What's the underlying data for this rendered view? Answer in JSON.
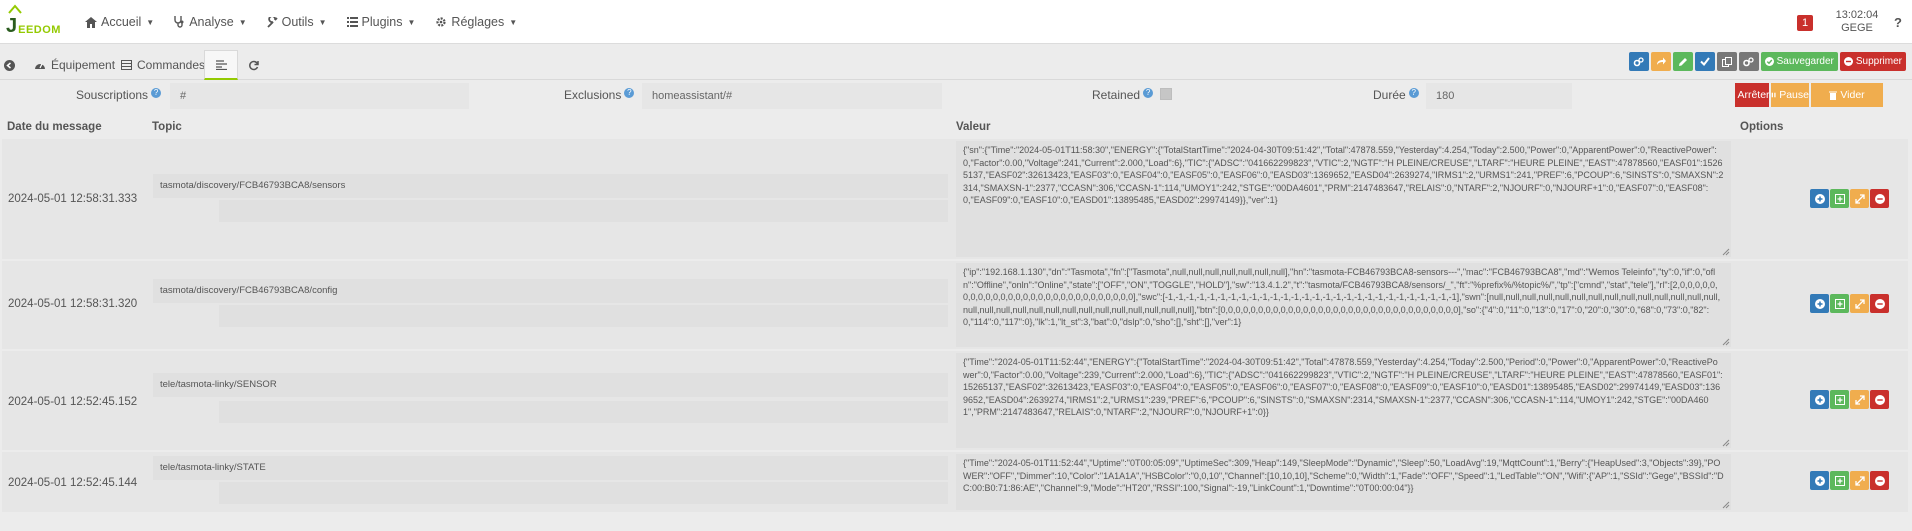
{
  "app": {
    "logo_text": "EEDOM",
    "logo_letter": "J"
  },
  "nav": {
    "items": [
      {
        "icon": "home-icon",
        "label": "Accueil"
      },
      {
        "icon": "stethoscope-icon",
        "label": "Analyse"
      },
      {
        "icon": "wrench-icon",
        "label": "Outils"
      },
      {
        "icon": "list-icon",
        "label": "Plugins"
      },
      {
        "icon": "cogs-icon",
        "label": "Réglages"
      }
    ],
    "alert_count": "1",
    "time": "13:02:04",
    "user": "GEGE",
    "help_glyph": "?"
  },
  "tabs": {
    "back_icon": "arrow-circle-left-icon",
    "equipment": "Équipement",
    "commands": "Commandes",
    "active_tab_icon": "list-lines-icon",
    "refresh_icon": "refresh-icon"
  },
  "actions": {
    "save": "Sauvegarder",
    "delete": "Supprimer",
    "colors": {
      "blue": "#337ab7",
      "orange": "#f0ad4e",
      "green": "#5cb85c",
      "gray": "#777777",
      "red": "#c9302c"
    }
  },
  "filters": {
    "subscriptions_label": "Souscriptions",
    "subscriptions_value": "#",
    "exclusions_label": "Exclusions",
    "exclusions_value": "homeassistant/#",
    "retained_label": "Retained",
    "duration_label": "Durée",
    "duration_value": "180",
    "stop_label": "Arrêter",
    "pause_label": "Pause",
    "clear_label": "Vider"
  },
  "table": {
    "headers": {
      "date": "Date du message",
      "topic": "Topic",
      "value": "Valeur",
      "options": "Options"
    },
    "rows": [
      {
        "date": "2024-05-01 12:58:31.333",
        "topic": "tasmota/discovery/FCB46793BCA8/sensors",
        "value": "{\"sn\":{\"Time\":\"2024-05-01T11:58:30\",\"ENERGY\":{\"TotalStartTime\":\"2024-04-30T09:51:42\",\"Total\":47878.559,\"Yesterday\":4.254,\"Today\":2.500,\"Power\":0,\"ApparentPower\":0,\"ReactivePower\":0,\"Factor\":0.00,\"Voltage\":241,\"Current\":2.000,\"Load\":6},\"TIC\":{\"ADSC\":\"041662299823\",\"VTIC\":2,\"NGTF\":\"H PLEINE/CREUSE\",\"LTARF\":\"HEURE PLEINE\",\"EAST\":47878560,\"EASF01\":15265137,\"EASF02\":32613423,\"EASF03\":0,\"EASF04\":0,\"EASF05\":0,\"EASF06\":0,\"EASD03\":1369652,\"EASD04\":2639274,\"IRMS1\":2,\"URMS1\":241,\"PREF\":6,\"PCOUP\":6,\"SINSTS\":0,\"SMAXSN\":2314,\"SMAXSN-1\":2377,\"CCASN\":306,\"CCASN-1\":114,\"UMOY1\":242,\"STGE\":\"00DA4601\",\"PRM\":2147483647,\"RELAIS\":0,\"NTARF\":2,\"NJOURF\":0,\"NJOURF+1\":0,\"EASF07\":0,\"EASF08\":0,\"EASF09\":0,\"EASF10\":0,\"EASD01\":13895485,\"EASD02\":29974149}},\"ver\":1}"
      },
      {
        "date": "2024-05-01 12:58:31.320",
        "topic": "tasmota/discovery/FCB46793BCA8/config",
        "value": "{\"ip\":\"192.168.1.130\",\"dn\":\"Tasmota\",\"fn\":[\"Tasmota\",null,null,null,null,null,null,null],\"hn\":\"tasmota-FCB46793BCA8-sensors---\",\"mac\":\"FCB46793BCA8\",\"md\":\"Wemos Teleinfo\",\"ty\":0,\"if\":0,\"ofln\":\"Offline\",\"onln\":\"Online\",\"state\":[\"OFF\",\"ON\",\"TOGGLE\",\"HOLD\"],\"sw\":\"13.4.1.2\",\"t\":\"tasmota/FCB46793BCA8/sensors/_\",\"ft\":\"%prefix%/%topic%/\",\"tp\":[\"cmnd\",\"stat\",\"tele\"],\"rl\":[2,0,0,0,0,0,0,0,0,0,0,0,0,0,0,0,0,0,0,0,0,0,0,0,0,0,0,0,0],\"swc\":[-1,-1,-1,-1,-1,-1,-1,-1,-1,-1,-1,-1,-1,-1,-1,-1,-1,-1,-1,-1,-1,-1,-1,-1,-1,-1,-1,-1],\"swn\":[null,null,null,null,null,null,null,null,null,null,null,null,null,null,null,null,null,null,null,null,null,null,null,null,null,null,null,null],\"btn\":[0,0,0,0,0,0,0,0,0,0,0,0,0,0,0,0,0,0,0,0,0,0,0,0,0,0,0,0,0,0,0,0],\"so\":{\"4\":0,\"11\":0,\"13\":0,\"17\":0,\"20\":0,\"30\":0,\"68\":0,\"73\":0,\"82\":0,\"114\":0,\"117\":0},\"lk\":1,\"lt_st\":3,\"bat\":0,\"dslp\":0,\"sho\":[],\"sht\":[],\"ver\":1}"
      },
      {
        "date": "2024-05-01 12:52:45.152",
        "topic": "tele/tasmota-linky/SENSOR",
        "value": "{\"Time\":\"2024-05-01T11:52:44\",\"ENERGY\":{\"TotalStartTime\":\"2024-04-30T09:51:42\",\"Total\":47878.559,\"Yesterday\":4.254,\"Today\":2.500,\"Period\":0,\"Power\":0,\"ApparentPower\":0,\"ReactivePower\":0,\"Factor\":0.00,\"Voltage\":239,\"Current\":2.000,\"Load\":6},\"TIC\":{\"ADSC\":\"041662299823\",\"VTIC\":2,\"NGTF\":\"H PLEINE/CREUSE\",\"LTARF\":\"HEURE PLEINE\",\"EAST\":47878560,\"EASF01\":15265137,\"EASF02\":32613423,\"EASF03\":0,\"EASF04\":0,\"EASF05\":0,\"EASF06\":0,\"EASF07\":0,\"EASF08\":0,\"EASF09\":0,\"EASF10\":0,\"EASD01\":13895485,\"EASD02\":29974149,\"EASD03\":1369652,\"EASD04\":2639274,\"IRMS1\":2,\"URMS1\":239,\"PREF\":6,\"PCOUP\":6,\"SINSTS\":0,\"SMAXSN\":2314,\"SMAXSN-1\":2377,\"CCASN\":306,\"CCASN-1\":114,\"UMOY1\":242,\"STGE\":\"00DA4601\",\"PRM\":2147483647,\"RELAIS\":0,\"NTARF\":2,\"NJOURF\":0,\"NJOURF+1\":0}}"
      },
      {
        "date": "2024-05-01 12:52:45.144",
        "topic": "tele/tasmota-linky/STATE",
        "value": "{\"Time\":\"2024-05-01T11:52:44\",\"Uptime\":\"0T00:05:09\",\"UptimeSec\":309,\"Heap\":149,\"SleepMode\":\"Dynamic\",\"Sleep\":50,\"LoadAvg\":19,\"MqttCount\":1,\"Berry\":{\"HeapUsed\":3,\"Objects\":39},\"POWER\":\"OFF\",\"Dimmer\":10,\"Color\":\"1A1A1A\",\"HSBColor\":\"0,0,10\",\"Channel\":[10,10,10],\"Scheme\":0,\"Width\":1,\"Fade\":\"OFF\",\"Speed\":1,\"LedTable\":\"ON\",\"Wifi\":{\"AP\":1,\"SSId\":\"Gege\",\"BSSId\":\"DC:00:B0:71:86:AE\",\"Channel\":9,\"Mode\":\"HT20\",\"RSSI\":100,\"Signal\":-19,\"LinkCount\":1,\"Downtime\":\"0T00:00:04\"}}"
      }
    ]
  }
}
